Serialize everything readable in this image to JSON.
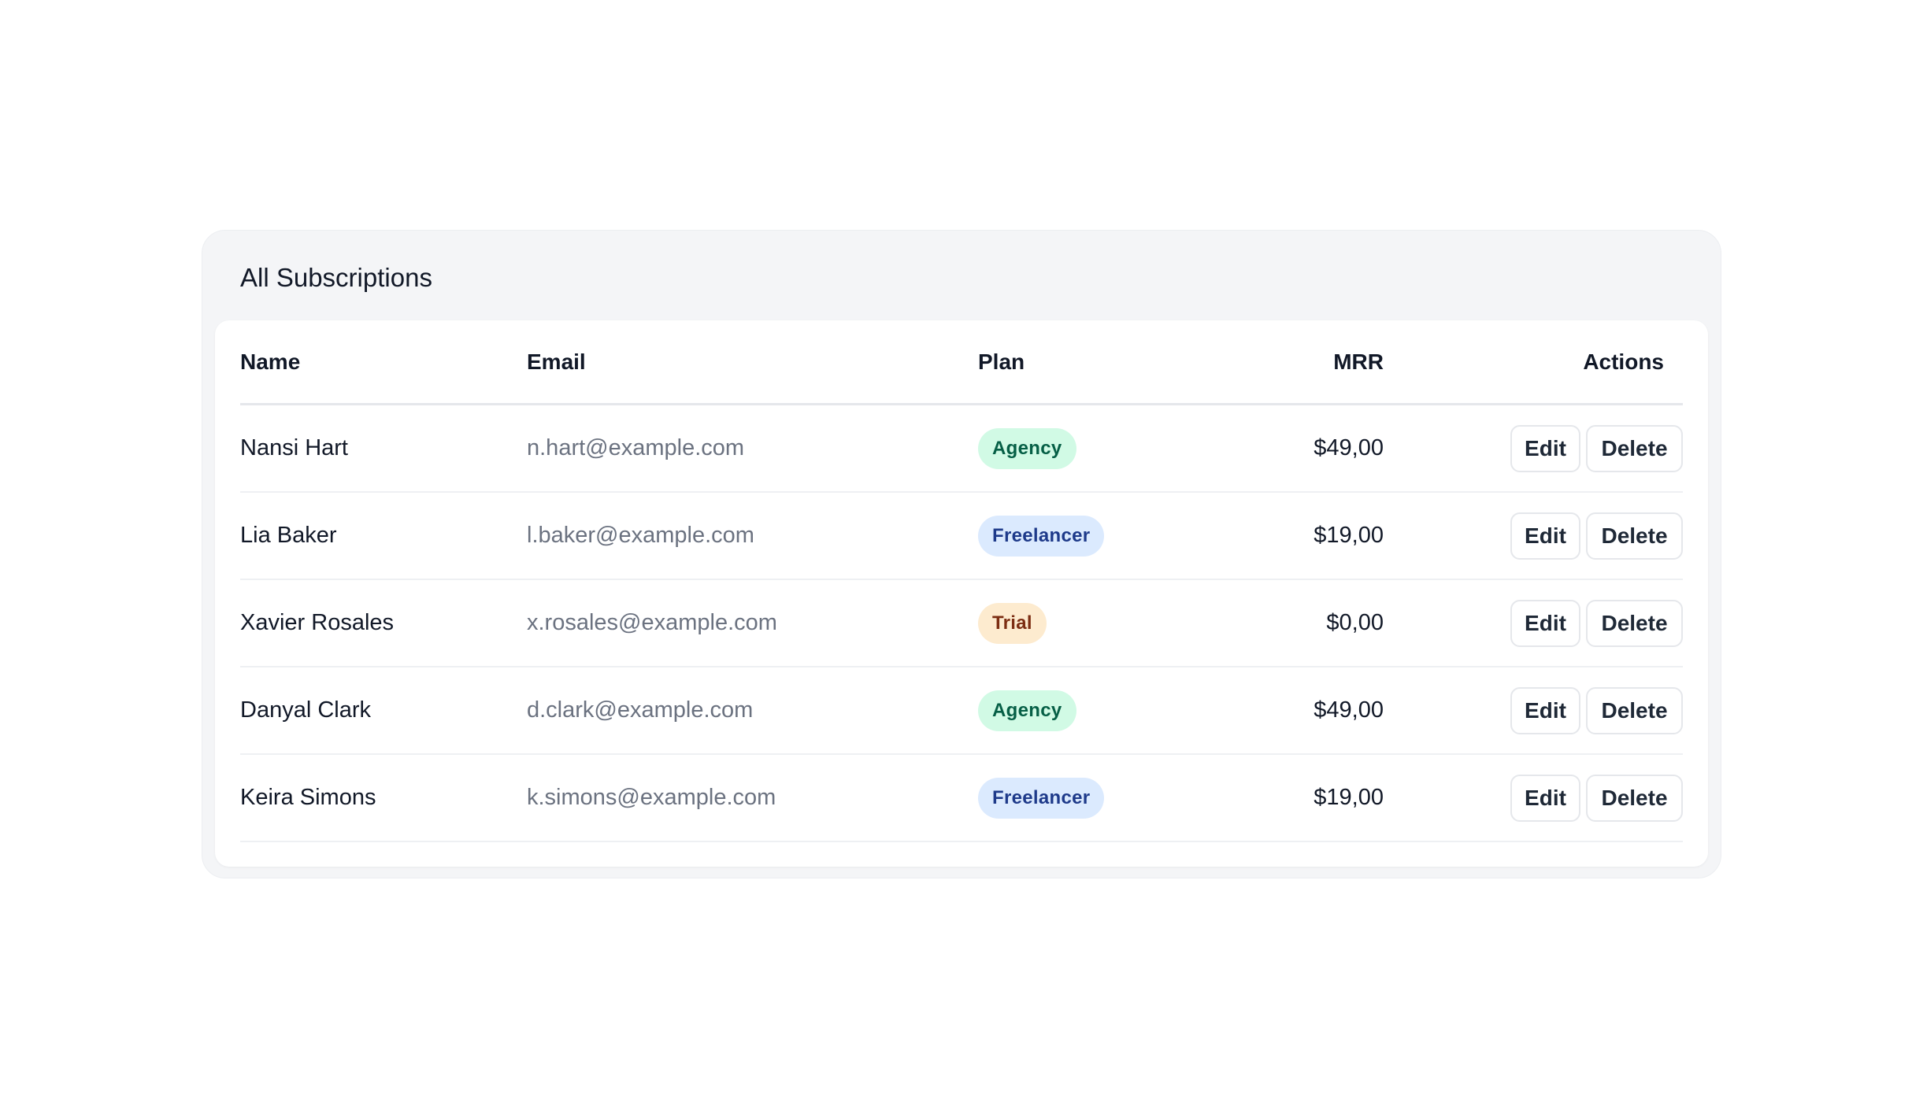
{
  "card": {
    "title": "All Subscriptions"
  },
  "table": {
    "headers": {
      "name": "Name",
      "email": "Email",
      "plan": "Plan",
      "mrr": "MRR",
      "actions": "Actions"
    },
    "rows": [
      {
        "name": "Nansi Hart",
        "email": "n.hart@example.com",
        "plan": "Agency",
        "plan_type": "agency",
        "mrr": "$49,00",
        "edit_label": "Edit",
        "delete_label": "Delete"
      },
      {
        "name": "Lia Baker",
        "email": "l.baker@example.com",
        "plan": "Freelancer",
        "plan_type": "freelancer",
        "mrr": "$19,00",
        "edit_label": "Edit",
        "delete_label": "Delete"
      },
      {
        "name": "Xavier Rosales",
        "email": "x.rosales@example.com",
        "plan": "Trial",
        "plan_type": "trial",
        "mrr": "$0,00",
        "edit_label": "Edit",
        "delete_label": "Delete"
      },
      {
        "name": "Danyal Clark",
        "email": "d.clark@example.com",
        "plan": "Agency",
        "plan_type": "agency",
        "mrr": "$49,00",
        "edit_label": "Edit",
        "delete_label": "Delete"
      },
      {
        "name": "Keira Simons",
        "email": "k.simons@example.com",
        "plan": "Freelancer",
        "plan_type": "freelancer",
        "mrr": "$19,00",
        "edit_label": "Edit",
        "delete_label": "Delete"
      }
    ]
  },
  "colors": {
    "card_background": "#f4f5f7",
    "agency_badge_bg": "#d1fae5",
    "agency_badge_text": "#065f46",
    "freelancer_badge_bg": "#dbeafe",
    "freelancer_badge_text": "#1e3a8a",
    "trial_badge_bg": "#fdebcf",
    "trial_badge_text": "#7c2d12"
  }
}
